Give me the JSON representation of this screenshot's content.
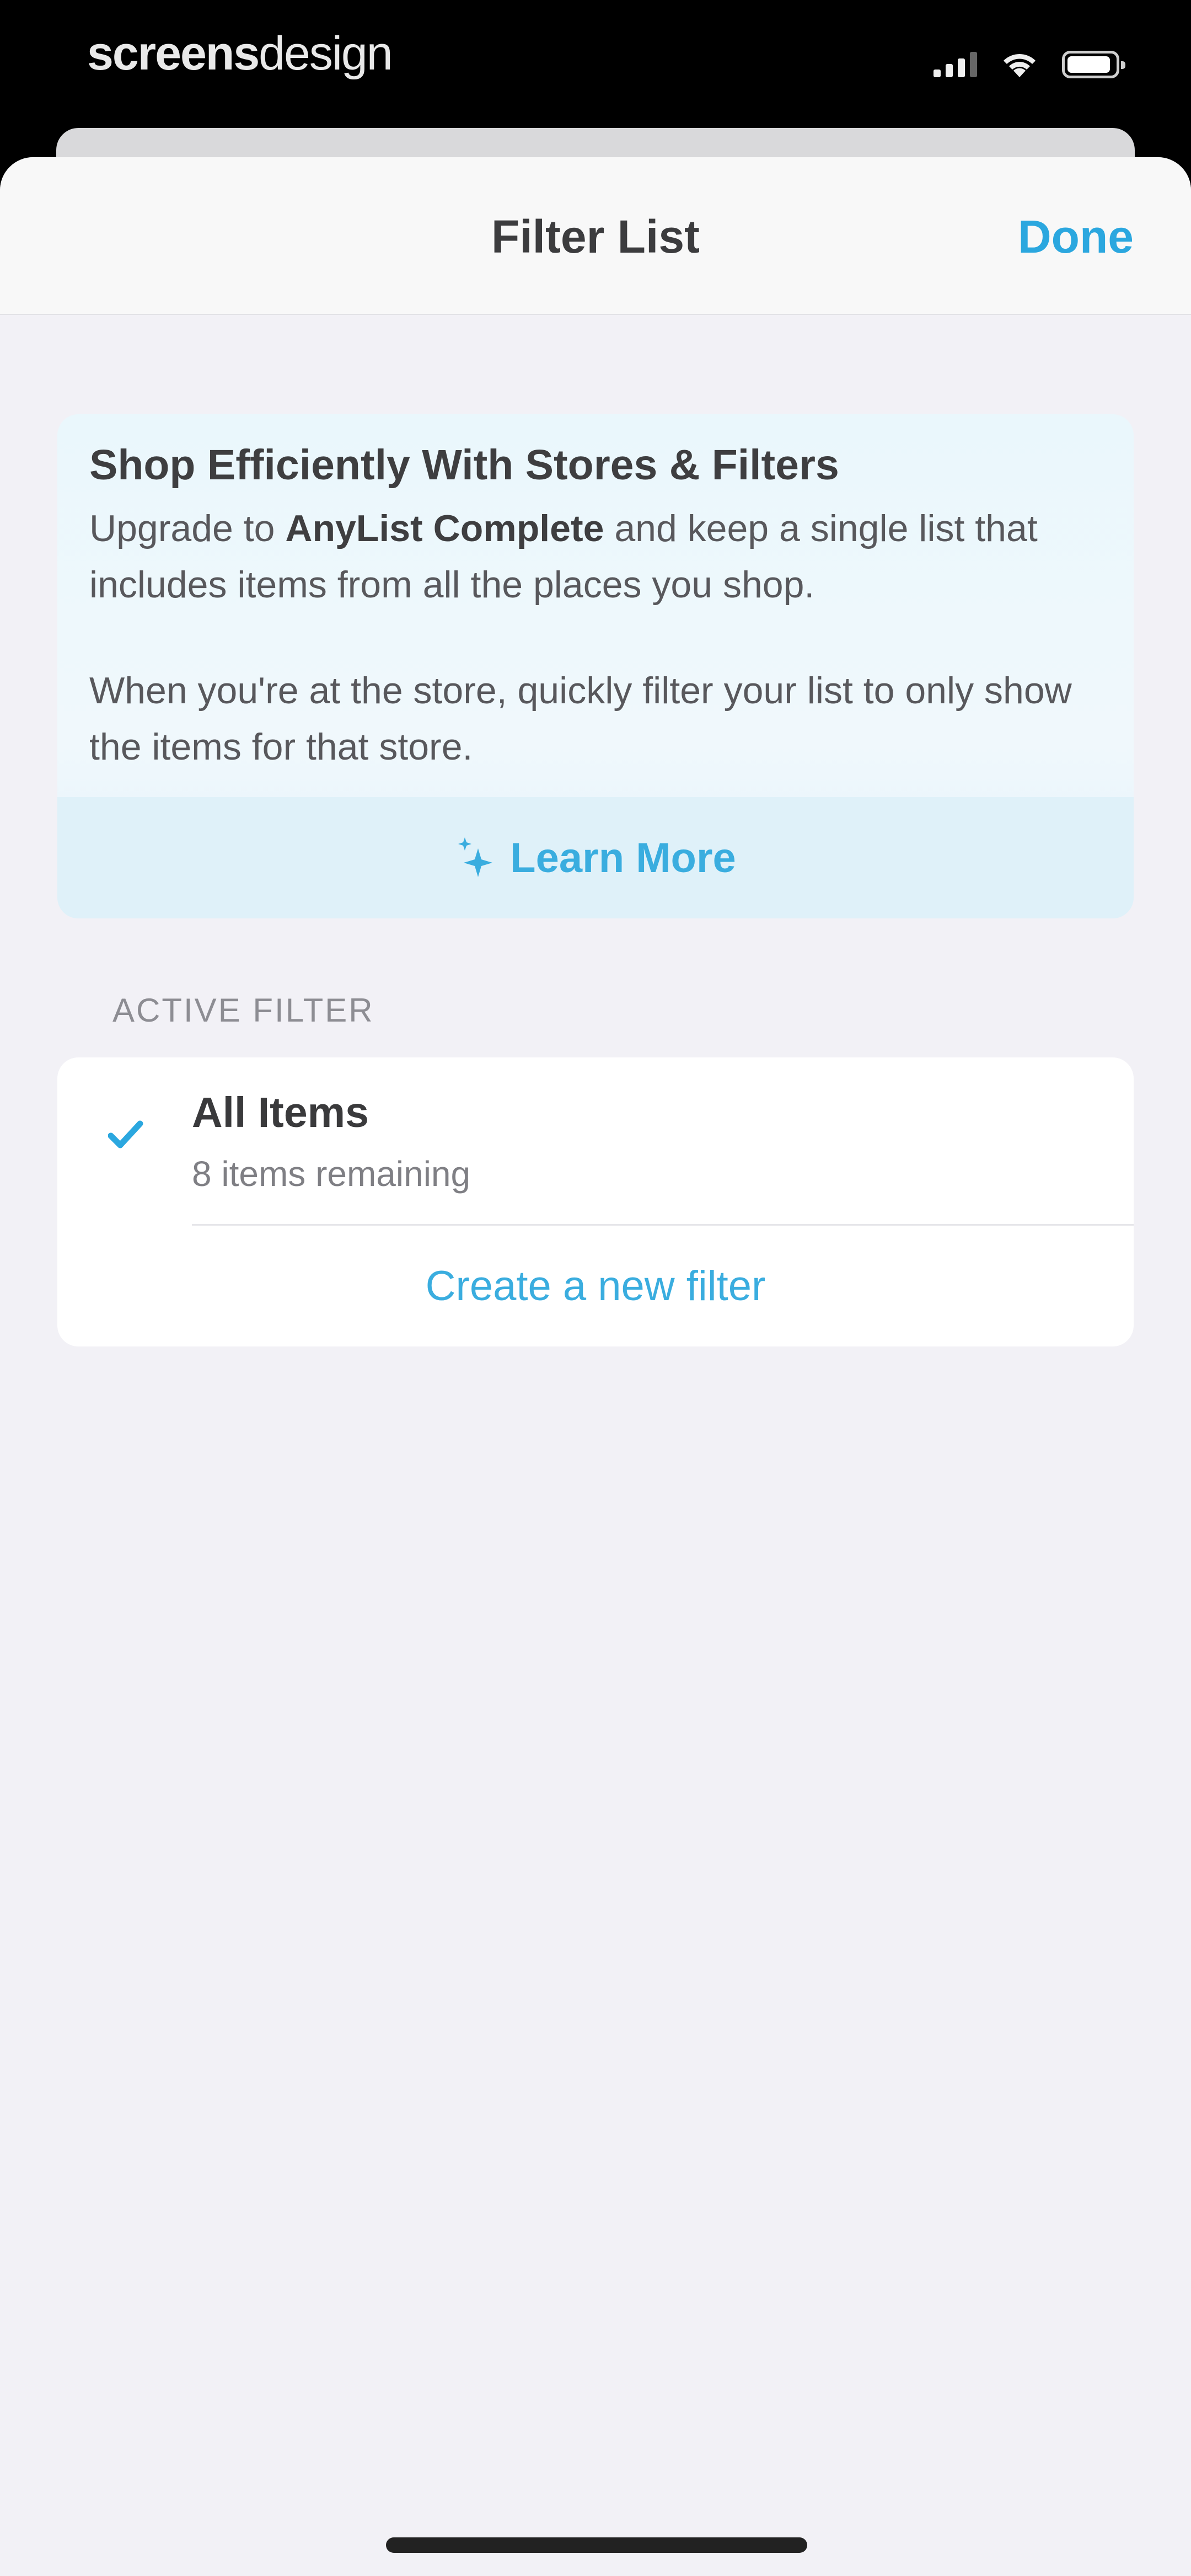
{
  "status_bar": {
    "brand_bold": "screens",
    "brand_light": "design",
    "signal_icon": "cellular-signal-icon",
    "wifi_icon": "wifi-icon",
    "battery_icon": "battery-icon"
  },
  "nav": {
    "title": "Filter List",
    "done_label": "Done"
  },
  "promo": {
    "title": "Shop Efficiently With Stores & Filters",
    "line1_before": "Upgrade to ",
    "line1_bold": "AnyList Complete",
    "line1_after": " and keep a single list that includes items from all the places you shop.",
    "paragraph2": "When you're at the store, quickly filter your list to only show the items for that store.",
    "learn_more_label": "Learn More",
    "learn_more_icon": "sparkle-icon"
  },
  "active_filter": {
    "section_label": "ACTIVE FILTER",
    "selected_icon": "checkmark-icon",
    "name": "All Items",
    "count_text": "8 items remaining",
    "create_label": "Create a new filter"
  },
  "colors": {
    "accent": "#2ba7df",
    "sheet_background": "#f2f1f6",
    "promo_background": "#eaf7fc"
  }
}
